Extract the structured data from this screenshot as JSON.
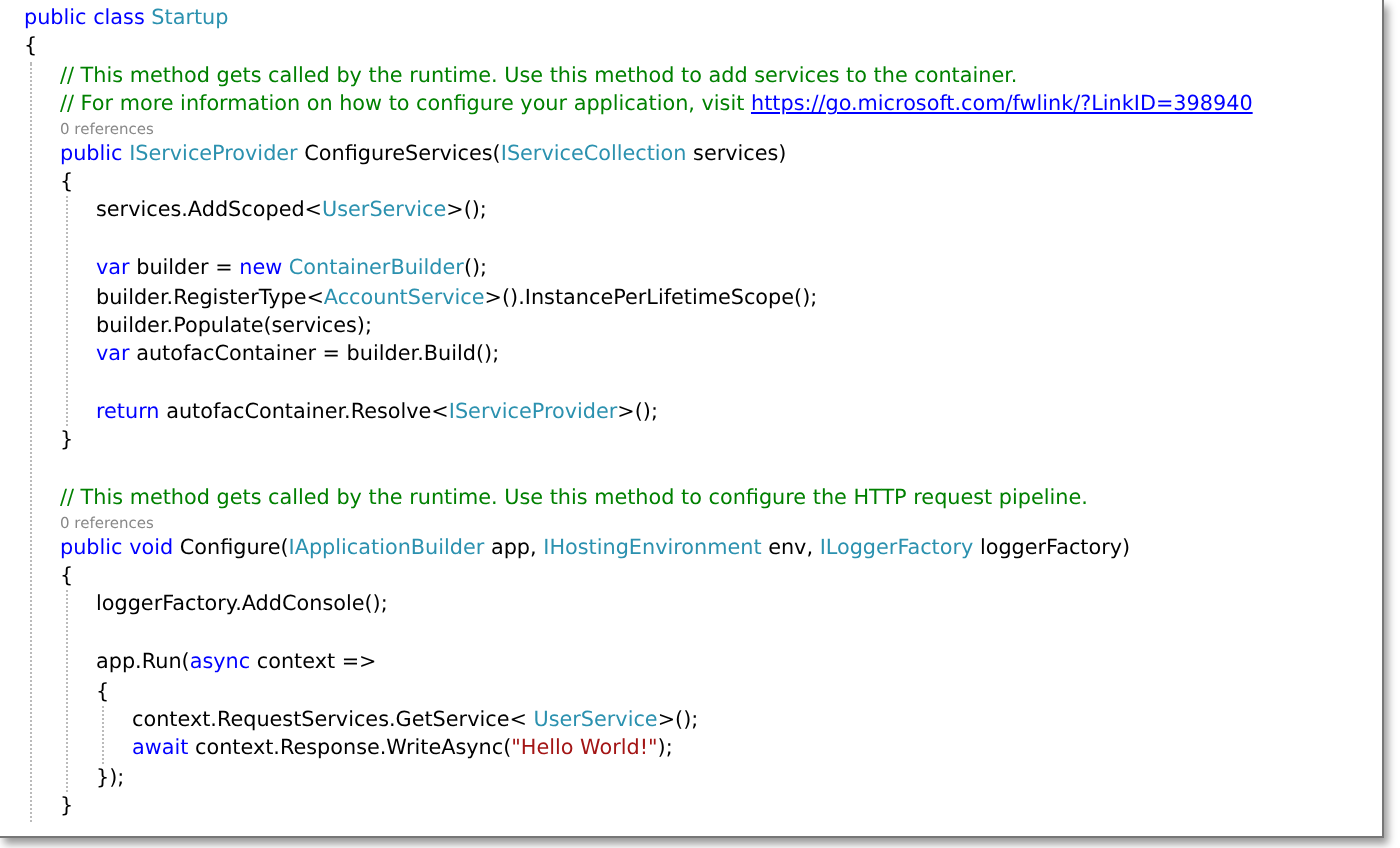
{
  "lines": [
    {
      "kind": "code",
      "tokens": [
        {
          "kind": "keyword",
          "text": "public class "
        },
        {
          "kind": "type",
          "text": "Startup"
        }
      ]
    },
    {
      "kind": "code",
      "tokens": [
        {
          "kind": "plain",
          "text": "{"
        }
      ],
      "children": [
        {
          "kind": "code",
          "tokens": [
            {
              "kind": "comment",
              "text": "// This method gets called by the runtime. Use this method to add services to the container."
            }
          ]
        },
        {
          "kind": "code",
          "tokens": [
            {
              "kind": "comment",
              "text": "// For more information on how to configure your application, visit "
            },
            {
              "kind": "link",
              "text": "https://go.microsoft.com/fwlink/?LinkID=398940"
            }
          ]
        },
        {
          "kind": "lens",
          "text": "0 references"
        },
        {
          "kind": "code",
          "tokens": [
            {
              "kind": "keyword",
              "text": "public "
            },
            {
              "kind": "type",
              "text": "IServiceProvider"
            },
            {
              "kind": "plain",
              "text": " ConfigureServices("
            },
            {
              "kind": "type",
              "text": "IServiceCollection"
            },
            {
              "kind": "plain",
              "text": " services)"
            }
          ]
        },
        {
          "kind": "code",
          "tokens": [
            {
              "kind": "plain",
              "text": "{"
            }
          ],
          "children": [
            {
              "kind": "code",
              "tokens": [
                {
                  "kind": "plain",
                  "text": "services.AddScoped<"
                },
                {
                  "kind": "type",
                  "text": "UserService"
                },
                {
                  "kind": "plain",
                  "text": ">();"
                }
              ]
            },
            {
              "kind": "blank"
            },
            {
              "kind": "code",
              "tokens": [
                {
                  "kind": "keyword",
                  "text": "var"
                },
                {
                  "kind": "plain",
                  "text": " builder = "
                },
                {
                  "kind": "keyword",
                  "text": "new "
                },
                {
                  "kind": "type",
                  "text": "ContainerBuilder"
                },
                {
                  "kind": "plain",
                  "text": "();"
                }
              ]
            },
            {
              "kind": "code",
              "tokens": [
                {
                  "kind": "plain",
                  "text": "builder.RegisterType<"
                },
                {
                  "kind": "type",
                  "text": "AccountService"
                },
                {
                  "kind": "plain",
                  "text": ">().InstancePerLifetimeScope();"
                }
              ]
            },
            {
              "kind": "code",
              "tokens": [
                {
                  "kind": "plain",
                  "text": "builder.Populate(services);"
                }
              ]
            },
            {
              "kind": "code",
              "tokens": [
                {
                  "kind": "keyword",
                  "text": "var"
                },
                {
                  "kind": "plain",
                  "text": " autofacContainer = builder.Build();"
                }
              ]
            },
            {
              "kind": "blank"
            },
            {
              "kind": "code",
              "tokens": [
                {
                  "kind": "keyword",
                  "text": "return"
                },
                {
                  "kind": "plain",
                  "text": " autofacContainer.Resolve<"
                },
                {
                  "kind": "type",
                  "text": "IServiceProvider"
                },
                {
                  "kind": "plain",
                  "text": ">();"
                }
              ]
            }
          ]
        },
        {
          "kind": "code",
          "tokens": [
            {
              "kind": "plain",
              "text": "}"
            }
          ]
        },
        {
          "kind": "blank"
        },
        {
          "kind": "code",
          "tokens": [
            {
              "kind": "comment",
              "text": "// This method gets called by the runtime. Use this method to configure the HTTP request pipeline."
            }
          ]
        },
        {
          "kind": "lens",
          "text": "0 references"
        },
        {
          "kind": "code",
          "tokens": [
            {
              "kind": "keyword",
              "text": "public void"
            },
            {
              "kind": "plain",
              "text": " Configure("
            },
            {
              "kind": "type",
              "text": "IApplicationBuilder"
            },
            {
              "kind": "plain",
              "text": " app, "
            },
            {
              "kind": "type",
              "text": "IHostingEnvironment"
            },
            {
              "kind": "plain",
              "text": " env, "
            },
            {
              "kind": "type",
              "text": "ILoggerFactory"
            },
            {
              "kind": "plain",
              "text": " loggerFactory)"
            }
          ]
        },
        {
          "kind": "code",
          "tokens": [
            {
              "kind": "plain",
              "text": "{"
            }
          ],
          "children": [
            {
              "kind": "code",
              "tokens": [
                {
                  "kind": "plain",
                  "text": "loggerFactory.AddConsole();"
                }
              ]
            },
            {
              "kind": "blank"
            },
            {
              "kind": "code",
              "tokens": [
                {
                  "kind": "plain",
                  "text": "app.Run("
                },
                {
                  "kind": "keyword",
                  "text": "async"
                },
                {
                  "kind": "plain",
                  "text": " context =>"
                }
              ]
            },
            {
              "kind": "code",
              "tokens": [
                {
                  "kind": "plain",
                  "text": "{"
                }
              ],
              "children": [
                {
                  "kind": "code",
                  "tokens": [
                    {
                      "kind": "plain",
                      "text": "context.RequestServices.GetService< "
                    },
                    {
                      "kind": "type",
                      "text": "UserService"
                    },
                    {
                      "kind": "plain",
                      "text": ">();"
                    }
                  ]
                },
                {
                  "kind": "code",
                  "tokens": [
                    {
                      "kind": "keyword",
                      "text": "await"
                    },
                    {
                      "kind": "plain",
                      "text": " context.Response.WriteAsync("
                    },
                    {
                      "kind": "string",
                      "text": "\"Hello World!\""
                    },
                    {
                      "kind": "plain",
                      "text": ");"
                    }
                  ]
                }
              ]
            },
            {
              "kind": "code",
              "tokens": [
                {
                  "kind": "plain",
                  "text": "});"
                }
              ]
            }
          ]
        },
        {
          "kind": "code",
          "tokens": [
            {
              "kind": "plain",
              "text": "}"
            }
          ]
        }
      ]
    }
  ]
}
